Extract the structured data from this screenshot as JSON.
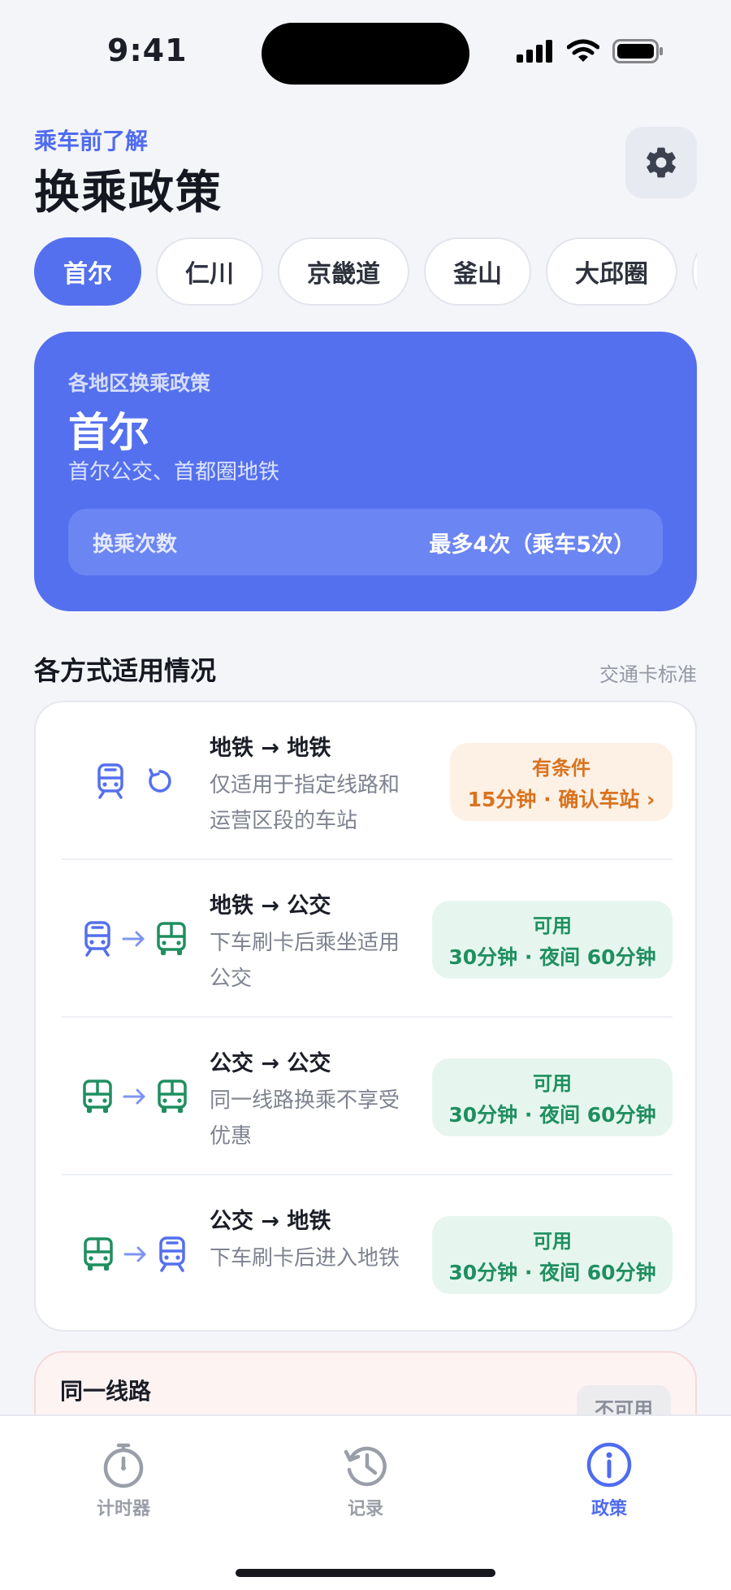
{
  "status_bar": {
    "time": "9:41"
  },
  "header": {
    "subtitle": "乘车前了解",
    "title": "换乘政策",
    "settings_icon": "gear-icon"
  },
  "regions": [
    {
      "label": "首尔",
      "active": true
    },
    {
      "label": "仁川",
      "active": false
    },
    {
      "label": "京畿道",
      "active": false
    },
    {
      "label": "釜山",
      "active": false
    },
    {
      "label": "大邱圈",
      "active": false
    }
  ],
  "hero": {
    "label": "各地区换乘政策",
    "city": "首尔",
    "description": "首尔公交、首都圈地铁",
    "transfer_label": "换乘次数",
    "transfer_value": "最多4次（乘车5次）"
  },
  "section": {
    "title": "各方式适用情况",
    "note": "交通卡标准"
  },
  "modes": [
    {
      "title": "地铁 → 地铁",
      "description": "仅适用于指定线路和运营区段的车站",
      "status": "有条件",
      "detail": "15分钟 · 确认车站 ›",
      "kind": "conditional",
      "from_icon": "subway-icon",
      "to_icon": "refresh-icon"
    },
    {
      "title": "地铁 → 公交",
      "description": "下车刷卡后乘坐适用公交",
      "status": "可用",
      "detail": "30分钟 · 夜间 60分钟",
      "kind": "available",
      "from_icon": "subway-icon",
      "to_icon": "bus-icon"
    },
    {
      "title": "公交 → 公交",
      "description": "同一线路换乘不享受优惠",
      "status": "可用",
      "detail": "30分钟 · 夜间 60分钟",
      "kind": "available",
      "from_icon": "bus-icon",
      "to_icon": "bus-icon"
    },
    {
      "title": "公交 → 地铁",
      "description": "下车刷卡后进入地铁",
      "status": "可用",
      "detail": "30分钟 · 夜间 60分钟",
      "kind": "available",
      "from_icon": "bus-icon",
      "to_icon": "subway-icon"
    }
  ],
  "same_line": {
    "title": "同一线路",
    "badge": "不可用"
  },
  "tabs": [
    {
      "label": "计时器",
      "icon": "stopwatch-icon",
      "active": false
    },
    {
      "label": "记录",
      "icon": "history-icon",
      "active": false
    },
    {
      "label": "政策",
      "icon": "info-icon",
      "active": true
    }
  ],
  "colors": {
    "accent": "#5470EE",
    "subway": "#5470EE",
    "bus": "#1F8F5F",
    "conditional": "#D9731E"
  }
}
